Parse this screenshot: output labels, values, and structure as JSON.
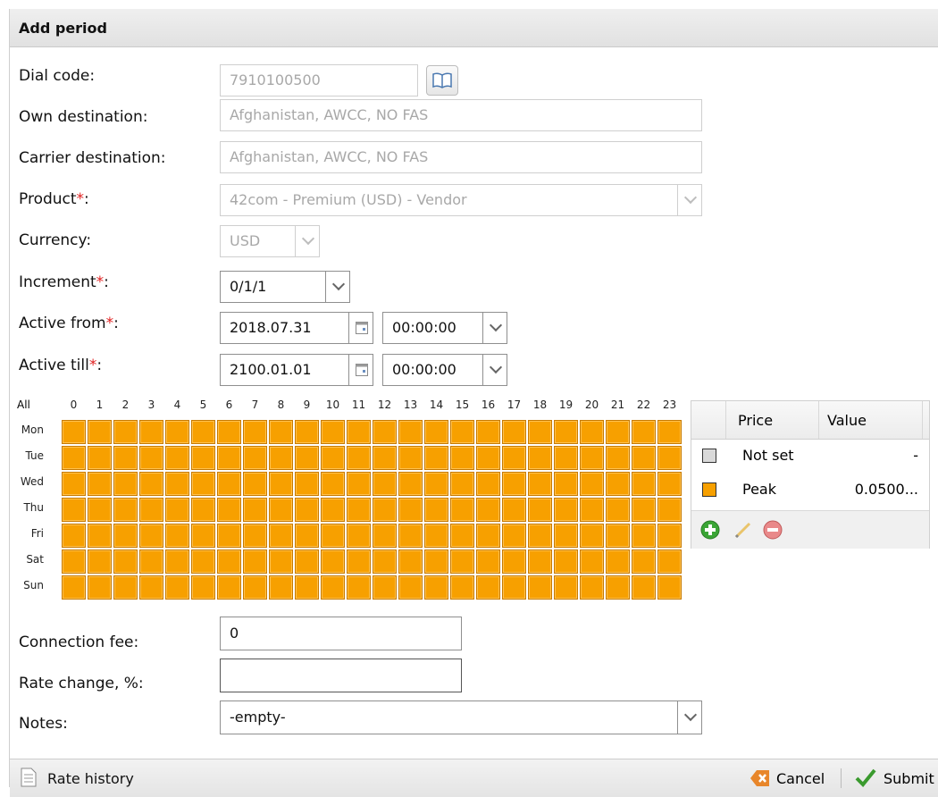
{
  "dialog": {
    "title": "Add period"
  },
  "form": {
    "dial_code": {
      "label": "Dial code:",
      "value": "7910100500"
    },
    "own_destination": {
      "label": "Own destination:",
      "value": "Afghanistan, AWCC, NO FAS"
    },
    "carrier_destination": {
      "label": "Carrier destination:",
      "value": "Afghanistan, AWCC, NO FAS"
    },
    "product": {
      "label": "Product",
      "required_mark": "*",
      "colon": ":",
      "value": "42com - Premium (USD) - Vendor"
    },
    "currency": {
      "label": "Currency:",
      "value": "USD"
    },
    "increment": {
      "label": "Increment",
      "required_mark": "*",
      "colon": ":",
      "value": "0/1/1"
    },
    "active_from": {
      "label": "Active from",
      "required_mark": "*",
      "colon": ":",
      "date": "2018.07.31",
      "time": "00:00:00"
    },
    "active_till": {
      "label": "Active till",
      "required_mark": "*",
      "colon": ":",
      "date": "2100.01.01",
      "time": "00:00:00"
    },
    "connection_fee": {
      "label": "Connection fee:",
      "value": "0"
    },
    "rate_change": {
      "label": "Rate change, %:",
      "value": ""
    },
    "notes": {
      "label": "Notes:",
      "value": "-empty-"
    }
  },
  "schedule": {
    "all_label": "All",
    "hours": [
      "0",
      "1",
      "2",
      "3",
      "4",
      "5",
      "6",
      "7",
      "8",
      "9",
      "10",
      "11",
      "12",
      "13",
      "14",
      "15",
      "16",
      "17",
      "18",
      "19",
      "20",
      "21",
      "22",
      "23"
    ],
    "days": [
      "Mon",
      "Tue",
      "Wed",
      "Thu",
      "Fri",
      "Sat",
      "Sun"
    ],
    "fill_color": "#f7a000",
    "all_cells_price": "Peak"
  },
  "price_table": {
    "headers": {
      "price": "Price",
      "value": "Value"
    },
    "rows": [
      {
        "name": "Not set",
        "value": "-",
        "color": "#d9d9d9"
      },
      {
        "name": "Peak",
        "value": "0.0500...",
        "color": "#f7a000"
      }
    ],
    "tools": [
      "add-icon",
      "edit-icon",
      "remove-icon"
    ]
  },
  "footer": {
    "rate_history": "Rate history",
    "cancel": "Cancel",
    "submit": "Submit"
  }
}
